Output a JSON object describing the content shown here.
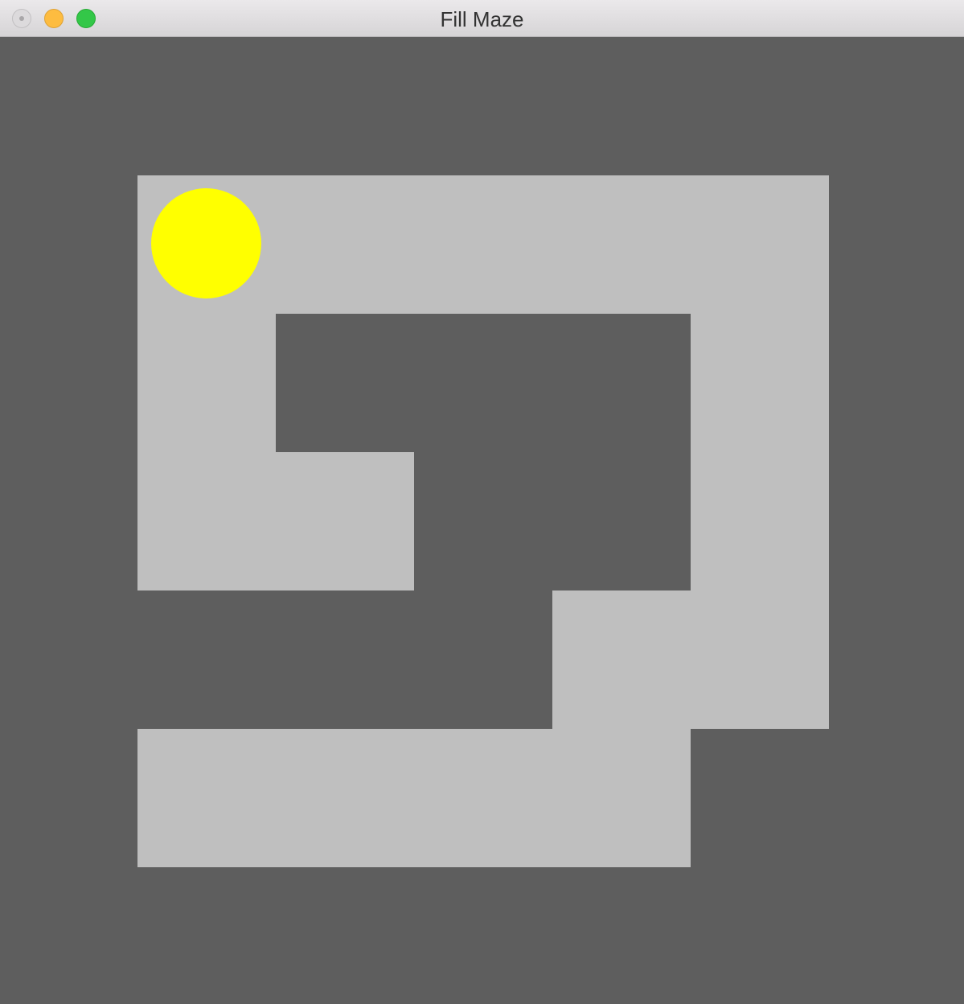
{
  "window": {
    "title": "Fill Maze"
  },
  "colors": {
    "wall": "#5e5e5e",
    "path": "#bfbfbf",
    "ball": "#ffff00"
  },
  "maze": {
    "rows": [
      "0000000",
      "0111110",
      "0100010",
      "0110010",
      "0000110",
      "0111100",
      "0000000"
    ],
    "ball_position": {
      "row": 1,
      "col": 1
    }
  }
}
